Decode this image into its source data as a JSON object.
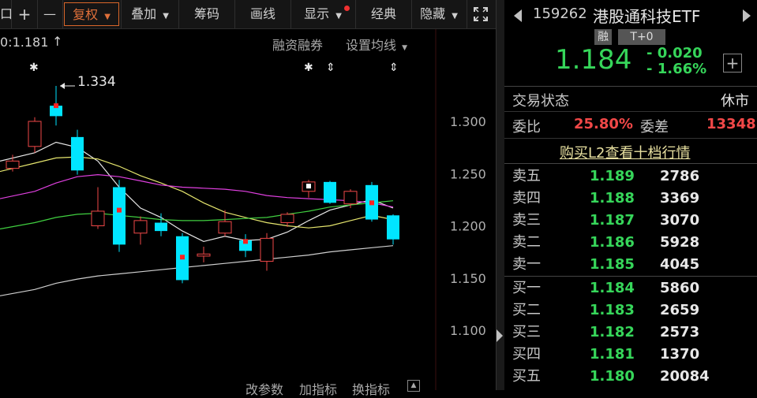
{
  "toolbar": {
    "items": [
      {
        "label": "",
        "name": "toolbar-left-edge"
      },
      {
        "label": "+",
        "name": "zoom-in-button"
      },
      {
        "label": "—",
        "name": "zoom-out-button"
      },
      {
        "label": "复权",
        "name": "adjust-button"
      },
      {
        "label": "叠加",
        "name": "overlay-button"
      },
      {
        "label": "筹码",
        "name": "chips-button"
      },
      {
        "label": "画线",
        "name": "draw-line-button"
      },
      {
        "label": "显示",
        "name": "display-button"
      },
      {
        "label": "经典",
        "name": "classic-button"
      },
      {
        "label": "隐藏",
        "name": "hide-button"
      }
    ]
  },
  "chart_header": {
    "ratio_text": "0:1.181",
    "margin_text": "融资融券",
    "ma_text": "设置均线",
    "high_label": "1.334"
  },
  "chart_bottom": {
    "items": [
      "改参数",
      "加指标",
      "换指标"
    ]
  },
  "chart_data": {
    "type": "candlestick",
    "y_axis_labels": [
      "1.300",
      "1.250",
      "1.200",
      "1.150",
      "1.100"
    ],
    "ylim": [
      1.085,
      1.355
    ],
    "candles": [
      {
        "o": 1.262,
        "c": 1.255,
        "h": 1.268,
        "l": 1.252,
        "up": true
      },
      {
        "o": 1.276,
        "c": 1.3,
        "h": 1.304,
        "l": 1.27,
        "up": true
      },
      {
        "o": 1.315,
        "c": 1.305,
        "h": 1.334,
        "l": 1.296,
        "up": false
      },
      {
        "o": 1.285,
        "c": 1.253,
        "h": 1.292,
        "l": 1.249,
        "up": false
      },
      {
        "o": 1.2,
        "c": 1.214,
        "h": 1.237,
        "l": 1.197,
        "up": true
      },
      {
        "o": 1.237,
        "c": 1.182,
        "h": 1.244,
        "l": 1.175,
        "up": false
      },
      {
        "o": 1.193,
        "c": 1.205,
        "h": 1.209,
        "l": 1.182,
        "up": true
      },
      {
        "o": 1.203,
        "c": 1.195,
        "h": 1.212,
        "l": 1.19,
        "up": false
      },
      {
        "o": 1.19,
        "c": 1.148,
        "h": 1.193,
        "l": 1.145,
        "up": false
      },
      {
        "o": 1.173,
        "c": 1.171,
        "h": 1.18,
        "l": 1.165,
        "up": true
      },
      {
        "o": 1.193,
        "c": 1.204,
        "h": 1.215,
        "l": 1.19,
        "up": true
      },
      {
        "o": 1.186,
        "c": 1.176,
        "h": 1.192,
        "l": 1.17,
        "up": false
      },
      {
        "o": 1.166,
        "c": 1.188,
        "h": 1.193,
        "l": 1.157,
        "up": true
      },
      {
        "o": 1.203,
        "c": 1.211,
        "h": 1.213,
        "l": 1.199,
        "up": true
      },
      {
        "o": 1.233,
        "c": 1.242,
        "h": 1.244,
        "l": 1.227,
        "up": true
      },
      {
        "o": 1.242,
        "c": 1.222,
        "h": 1.243,
        "l": 1.221,
        "up": false
      },
      {
        "o": 1.221,
        "c": 1.233,
        "h": 1.235,
        "l": 1.217,
        "up": true
      },
      {
        "o": 1.239,
        "c": 1.206,
        "h": 1.242,
        "l": 1.204,
        "up": false
      },
      {
        "o": 1.21,
        "c": 1.187,
        "h": 1.211,
        "l": 1.182,
        "up": false
      }
    ],
    "ma_lines": [
      {
        "color": "#e8e8e8",
        "values": [
          1.262,
          1.27,
          1.28,
          1.275,
          1.262,
          1.237,
          1.217,
          1.208,
          1.195,
          1.185,
          1.19,
          1.186,
          1.187,
          1.194,
          1.205,
          1.215,
          1.22,
          1.225,
          1.217
        ]
      },
      {
        "color": "#e6e66e",
        "values": [
          1.252,
          1.26,
          1.265,
          1.266,
          1.264,
          1.257,
          1.248,
          1.241,
          1.233,
          1.222,
          1.213,
          1.208,
          1.203,
          1.2,
          1.198,
          1.2,
          1.205,
          1.21,
          1.206
        ]
      },
      {
        "color": "#e040e0",
        "values": [
          1.226,
          1.233,
          1.241,
          1.247,
          1.249,
          1.247,
          1.243,
          1.239,
          1.237,
          1.236,
          1.235,
          1.233,
          1.229,
          1.227,
          1.226,
          1.225,
          1.224,
          1.222,
          1.218
        ]
      },
      {
        "color": "#40d040",
        "values": [
          1.197,
          1.203,
          1.208,
          1.211,
          1.212,
          1.21,
          1.208,
          1.206,
          1.205,
          1.205,
          1.206,
          1.207,
          1.208,
          1.211,
          1.214,
          1.218,
          1.22,
          1.222,
          1.224
        ]
      },
      {
        "color": "#cfcfcf",
        "values": [
          1.133,
          1.139,
          1.145,
          1.149,
          1.152,
          1.154,
          1.156,
          1.158,
          1.16,
          1.162,
          1.164,
          1.166,
          1.168,
          1.17,
          1.172,
          1.175,
          1.177,
          1.179,
          1.181
        ]
      }
    ]
  },
  "right_panel": {
    "code": "159262",
    "name": "港股通科技ETF",
    "tag_margin": "融",
    "tag_t0": "T+0",
    "price": "1.184",
    "change": "- 0.020",
    "change_pct": "- 1.66%",
    "plus_label": "+",
    "status_label": "交易状态",
    "status_value": "休市",
    "ratio_label": "委比",
    "ratio_value": "25.80%",
    "diff_label": "委差",
    "diff_value": "13348",
    "l2_link": "购买L2查看十档行情",
    "sell_orders": [
      {
        "label": "卖五",
        "price": "1.189",
        "vol": "2786"
      },
      {
        "label": "卖四",
        "price": "1.188",
        "vol": "3369"
      },
      {
        "label": "卖三",
        "price": "1.187",
        "vol": "3070"
      },
      {
        "label": "卖二",
        "price": "1.186",
        "vol": "5928"
      },
      {
        "label": "卖一",
        "price": "1.185",
        "vol": "4045"
      }
    ],
    "buy_orders": [
      {
        "label": "买一",
        "price": "1.184",
        "vol": "5860"
      },
      {
        "label": "买二",
        "price": "1.183",
        "vol": "2659"
      },
      {
        "label": "买三",
        "price": "1.182",
        "vol": "2573"
      },
      {
        "label": "买四",
        "price": "1.181",
        "vol": "1370"
      },
      {
        "label": "买五",
        "price": "1.180",
        "vol": "20084"
      }
    ]
  }
}
